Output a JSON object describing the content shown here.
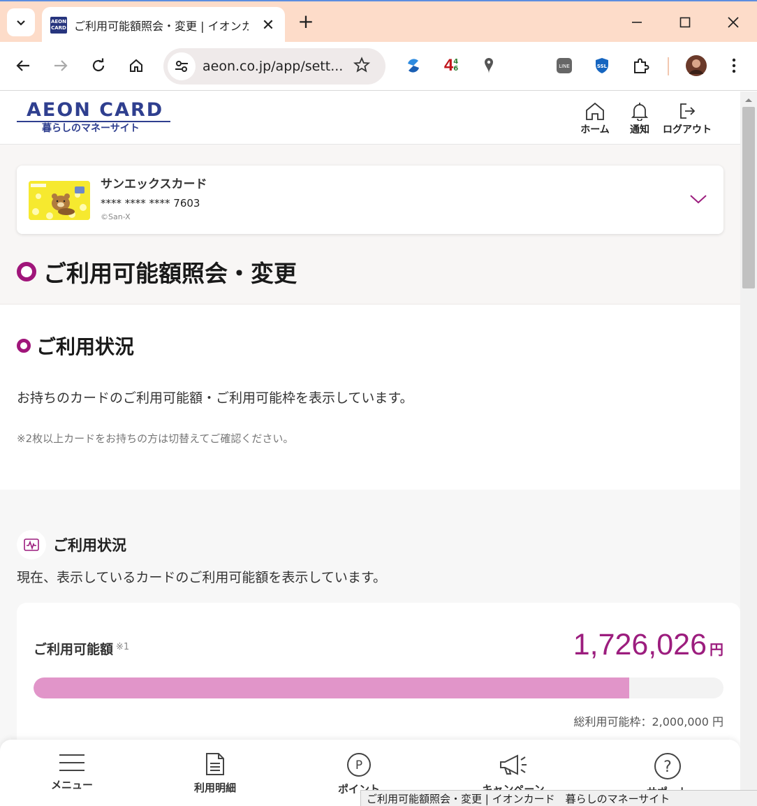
{
  "browser": {
    "tab_title": "ご利用可能額照会・変更 | イオンカ",
    "favicon_text_1": "AEON",
    "favicon_text_2": "CARD",
    "url": "aeon.co.jp/app/sett...",
    "ext_badge": "4",
    "ext_badge_sup": "4",
    "ext_badge_sub": "6"
  },
  "header": {
    "logo_main": "AEON CARD",
    "logo_sub": "暮らしのマネーサイト",
    "nav": [
      {
        "label": "ホーム",
        "icon": "home-icon"
      },
      {
        "label": "通知",
        "icon": "bell-icon"
      },
      {
        "label": "ログアウト",
        "icon": "logout-icon"
      }
    ]
  },
  "card": {
    "name": "サンエックスカード",
    "number": "**** **** **** 7603",
    "copyright": "©San-X"
  },
  "page_title": "ご利用可能額照会・変更",
  "usage_section": {
    "title": "ご利用状況",
    "description": "お持ちのカードのご利用可能額・ご利用可能枠を表示しています。",
    "note": "※2枚以上カードをお持ちの方は切替えてご確認ください。"
  },
  "usage_detail": {
    "title": "ご利用状況",
    "description": "現在、表示しているカードのご利用可能額を表示しています。",
    "available_label": "ご利用可能額",
    "available_note": "※1",
    "available_amount": "1,726,026",
    "currency": "円",
    "available_ratio": 0.863,
    "total_limit": "総利用可能枠：2,000,000 円"
  },
  "bottom_nav": [
    {
      "label": "メニュー",
      "icon": "hamburger-menu-icon"
    },
    {
      "label": "利用明細",
      "icon": "document-icon"
    },
    {
      "label": "ポイント",
      "icon": "point-icon"
    },
    {
      "label": "キャンペーン",
      "icon": "megaphone-icon"
    },
    {
      "label": "サポート",
      "icon": "help-icon"
    }
  ],
  "status_bar": "ご利用可能額照会・変更 | イオンカード　暮らしのマネーサイト",
  "colors": {
    "brand_navy": "#2f3f8f",
    "accent_magenta": "#9c1d7e",
    "progress_fill": "#e195c9",
    "tabstrip": "#fddcc9"
  }
}
